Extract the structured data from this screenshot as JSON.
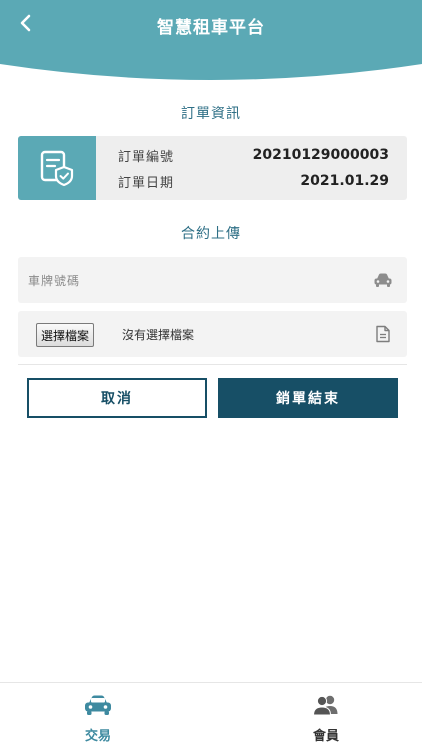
{
  "header": {
    "title": "智慧租車平台",
    "back_icon": "chevron-left-icon",
    "color": "#5ba9b5"
  },
  "order_section": {
    "title": "訂單資訊",
    "icon": "document-shield-icon",
    "number_label": "訂單編號",
    "number_value": "20210129000003",
    "date_label": "訂單日期",
    "date_value": "2021.01.29"
  },
  "contract_section": {
    "title": "合約上傳",
    "plate_placeholder": "車牌號碼",
    "plate_icon": "car-icon",
    "file_button_label": "選擇檔案",
    "file_status": "沒有選擇檔案",
    "file_icon": "document-icon"
  },
  "actions": {
    "cancel_label": "取消",
    "confirm_label": "銷單結束",
    "primary_color": "#174f66"
  },
  "bottom_nav": {
    "items": [
      {
        "label": "交易",
        "icon": "car-icon",
        "active": true
      },
      {
        "label": "會員",
        "icon": "users-icon",
        "active": false
      }
    ],
    "active_color": "#3e8aa0"
  }
}
